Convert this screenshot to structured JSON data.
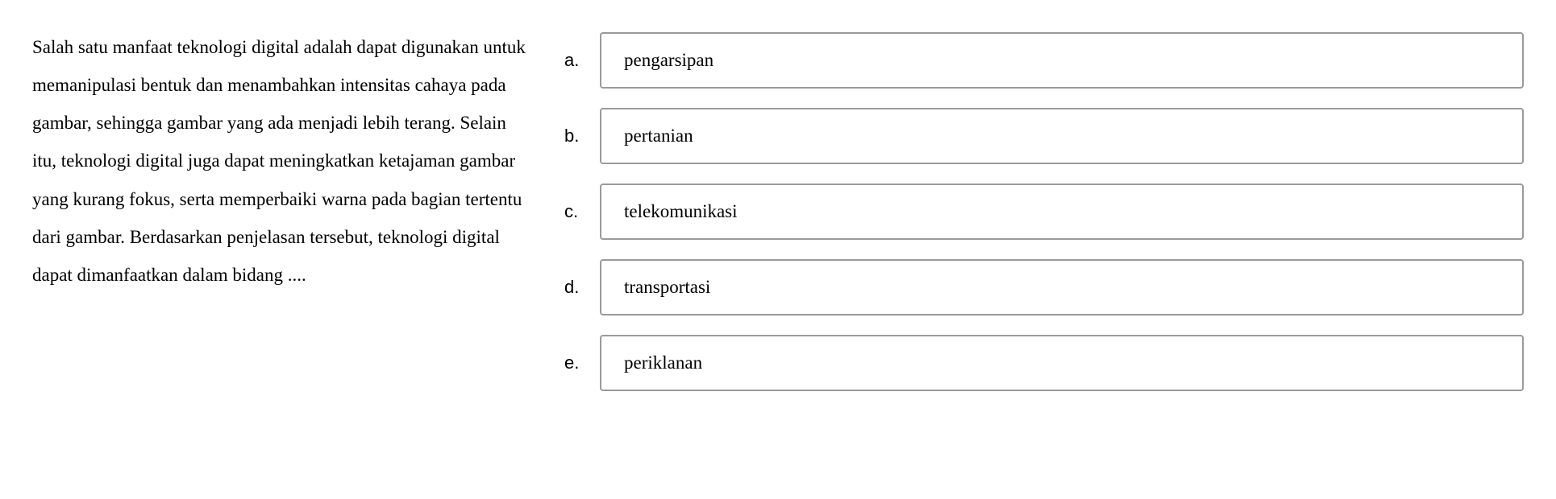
{
  "question": {
    "text": "Salah satu manfaat teknologi digital adalah dapat digunakan untuk memanipulasi bentuk dan menambahkan intensitas cahaya pada gambar, sehingga gambar yang ada menjadi lebih terang. Selain itu, teknologi digital juga dapat meningkatkan ketajaman gambar yang kurang fokus, serta memperbaiki warna pada bagian tertentu dari gambar. Berdasarkan penjelasan tersebut, teknologi digital dapat dimanfaatkan dalam bidang ...."
  },
  "options": [
    {
      "label": "a.",
      "text": "pengarsipan"
    },
    {
      "label": "b.",
      "text": "pertanian"
    },
    {
      "label": "c.",
      "text": "telekomunikasi"
    },
    {
      "label": "d.",
      "text": "transportasi"
    },
    {
      "label": "e.",
      "text": "periklanan"
    }
  ]
}
